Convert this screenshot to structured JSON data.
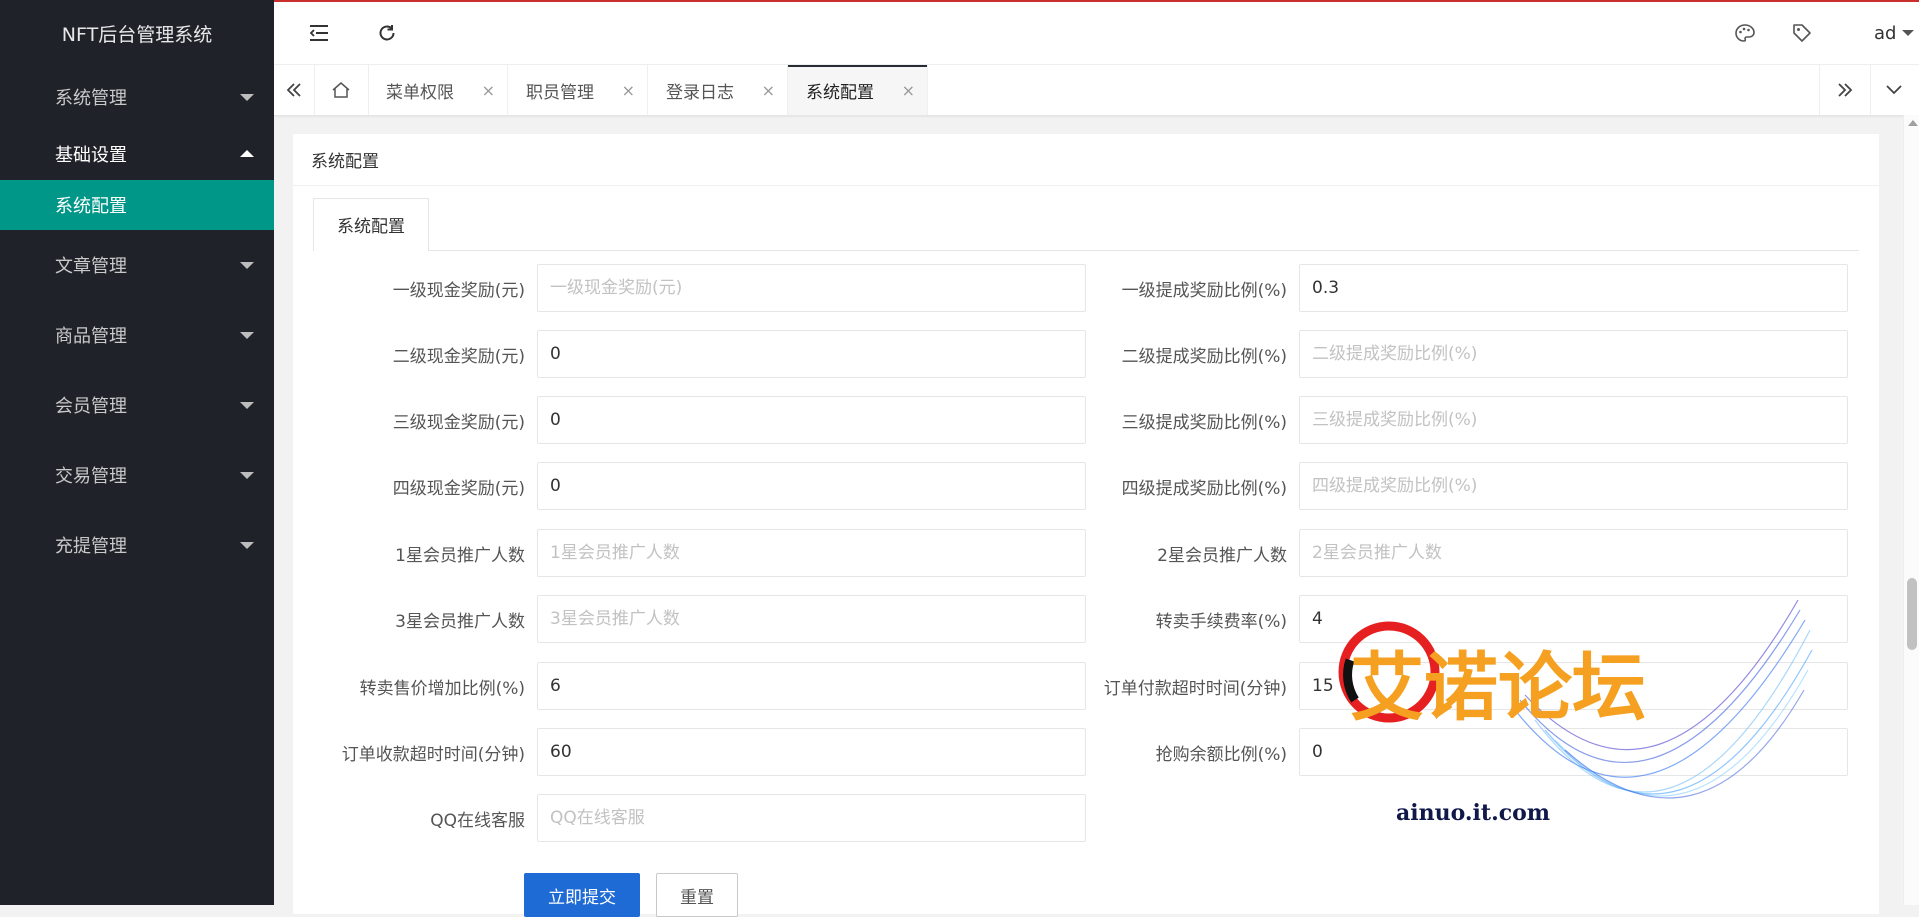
{
  "app": {
    "title": "NFT后台管理系统"
  },
  "sidebar": {
    "items": [
      {
        "label": "系统管理"
      },
      {
        "label": "基础设置",
        "expanded": true,
        "children": [
          {
            "label": "系统配置",
            "active": true
          }
        ]
      },
      {
        "label": "文章管理"
      },
      {
        "label": "商品管理"
      },
      {
        "label": "会员管理"
      },
      {
        "label": "交易管理"
      },
      {
        "label": "充提管理"
      }
    ]
  },
  "header": {
    "user": "ad",
    "icons": [
      "menu-fold-icon",
      "refresh-icon",
      "palette-icon",
      "tag-icon"
    ]
  },
  "tabs": [
    {
      "label": "菜单权限"
    },
    {
      "label": "职员管理"
    },
    {
      "label": "登录日志"
    },
    {
      "label": "系统配置",
      "active": true
    }
  ],
  "tab_close_glyph": "×",
  "main": {
    "card_title": "系统配置",
    "inner_tab": "系统配置",
    "left_fields": [
      {
        "label": "一级现金奖励(元)",
        "value": "",
        "placeholder": "一级现金奖励(元)"
      },
      {
        "label": "二级现金奖励(元)",
        "value": "0",
        "placeholder": "二级现金奖励(元)"
      },
      {
        "label": "三级现金奖励(元)",
        "value": "0",
        "placeholder": "三级现金奖励(元)"
      },
      {
        "label": "四级现金奖励(元)",
        "value": "0",
        "placeholder": "四级现金奖励(元)"
      },
      {
        "label": "1星会员推广人数",
        "value": "",
        "placeholder": "1星会员推广人数"
      },
      {
        "label": "3星会员推广人数",
        "value": "",
        "placeholder": "3星会员推广人数"
      },
      {
        "label": "转卖售价增加比例(%)",
        "value": "6",
        "placeholder": "转卖售价增加比例(%)"
      },
      {
        "label": "订单收款超时时间(分钟)",
        "value": "60",
        "placeholder": "订单收款超时时间(分钟)"
      },
      {
        "label": "QQ在线客服",
        "value": "",
        "placeholder": "QQ在线客服"
      }
    ],
    "right_fields": [
      {
        "label": "一级提成奖励比例(%)",
        "value": "0.3",
        "placeholder": "一级提成奖励比例(%)"
      },
      {
        "label": "二级提成奖励比例(%)",
        "value": "",
        "placeholder": "二级提成奖励比例(%)"
      },
      {
        "label": "三级提成奖励比例(%)",
        "value": "",
        "placeholder": "三级提成奖励比例(%)"
      },
      {
        "label": "四级提成奖励比例(%)",
        "value": "",
        "placeholder": "四级提成奖励比例(%)"
      },
      {
        "label": "2星会员推广人数",
        "value": "",
        "placeholder": "2星会员推广人数"
      },
      {
        "label": "转卖手续费率(%)",
        "value": "4",
        "placeholder": "转卖手续费率(%)"
      },
      {
        "label": "订单付款超时时间(分钟)",
        "value": "15",
        "placeholder": "订单付款超时时间(分钟)"
      },
      {
        "label": "抢购余额比例(%)",
        "value": "0",
        "placeholder": "抢购余额比例(%)"
      }
    ],
    "buttons": {
      "submit": "立即提交",
      "reset": "重置"
    }
  },
  "watermark": {
    "title": "艾诺论坛",
    "url": "ainuo.it.com"
  },
  "colors": {
    "sidebar": "#20222a",
    "active_menu": "#009688",
    "primary_button": "#1e6bd6",
    "accent_line": "#c9302c",
    "watermark_text": "#f5a020",
    "watermark_url": "#10184a"
  }
}
